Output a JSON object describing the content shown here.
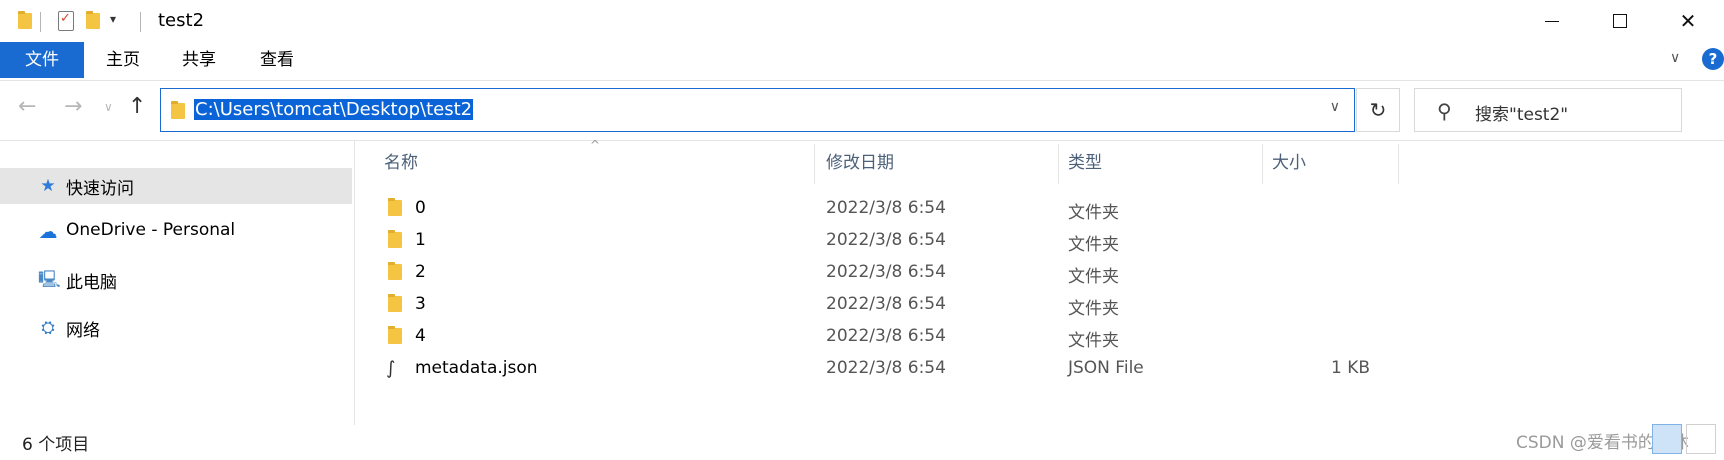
{
  "window": {
    "title": "test2",
    "minimize": "—",
    "maximize": "☐",
    "close": "✕"
  },
  "ribbon": {
    "tabs": [
      "文件",
      "主页",
      "共享",
      "查看"
    ],
    "collapse": "∨",
    "help": "?"
  },
  "address_bar": {
    "back": "←",
    "forward": "→",
    "recent": "∨",
    "up": "↑",
    "path": "C:\\Users\\tomcat\\Desktop\\test2",
    "dropdown": "∨",
    "refresh": "↻"
  },
  "search": {
    "placeholder": "搜索\"test2\"",
    "icon": "search-icon"
  },
  "nav_pane": {
    "items": [
      {
        "label": "快速访问",
        "icon": "star-icon",
        "selected": true
      },
      {
        "label": "OneDrive - Personal",
        "icon": "cloud-icon",
        "selected": false
      },
      {
        "label": "此电脑",
        "icon": "computer-icon",
        "selected": false
      },
      {
        "label": "网络",
        "icon": "network-icon",
        "selected": false
      }
    ]
  },
  "file_list": {
    "columns": [
      "名称",
      "修改日期",
      "类型",
      "大小"
    ],
    "sort_indicator": "^",
    "rows": [
      {
        "name": "0",
        "date": "2022/3/8 6:54",
        "type": "文件夹",
        "size": "",
        "icon": "folder-icon"
      },
      {
        "name": "1",
        "date": "2022/3/8 6:54",
        "type": "文件夹",
        "size": "",
        "icon": "folder-icon"
      },
      {
        "name": "2",
        "date": "2022/3/8 6:54",
        "type": "文件夹",
        "size": "",
        "icon": "folder-icon"
      },
      {
        "name": "3",
        "date": "2022/3/8 6:54",
        "type": "文件夹",
        "size": "",
        "icon": "folder-icon"
      },
      {
        "name": "4",
        "date": "2022/3/8 6:54",
        "type": "文件夹",
        "size": "",
        "icon": "folder-icon"
      },
      {
        "name": "metadata.json",
        "date": "2022/3/8 6:54",
        "type": "JSON File",
        "size": "1 KB",
        "icon": "json-file-icon"
      }
    ]
  },
  "status_bar": {
    "item_count": "6 个项目",
    "watermark": "CSDN @爱看书的小沐"
  },
  "colors": {
    "accent": "#1a6bd1",
    "selection": "#0a64d8",
    "folder": "#f3c542",
    "nav_selected": "#e5e5e5"
  }
}
